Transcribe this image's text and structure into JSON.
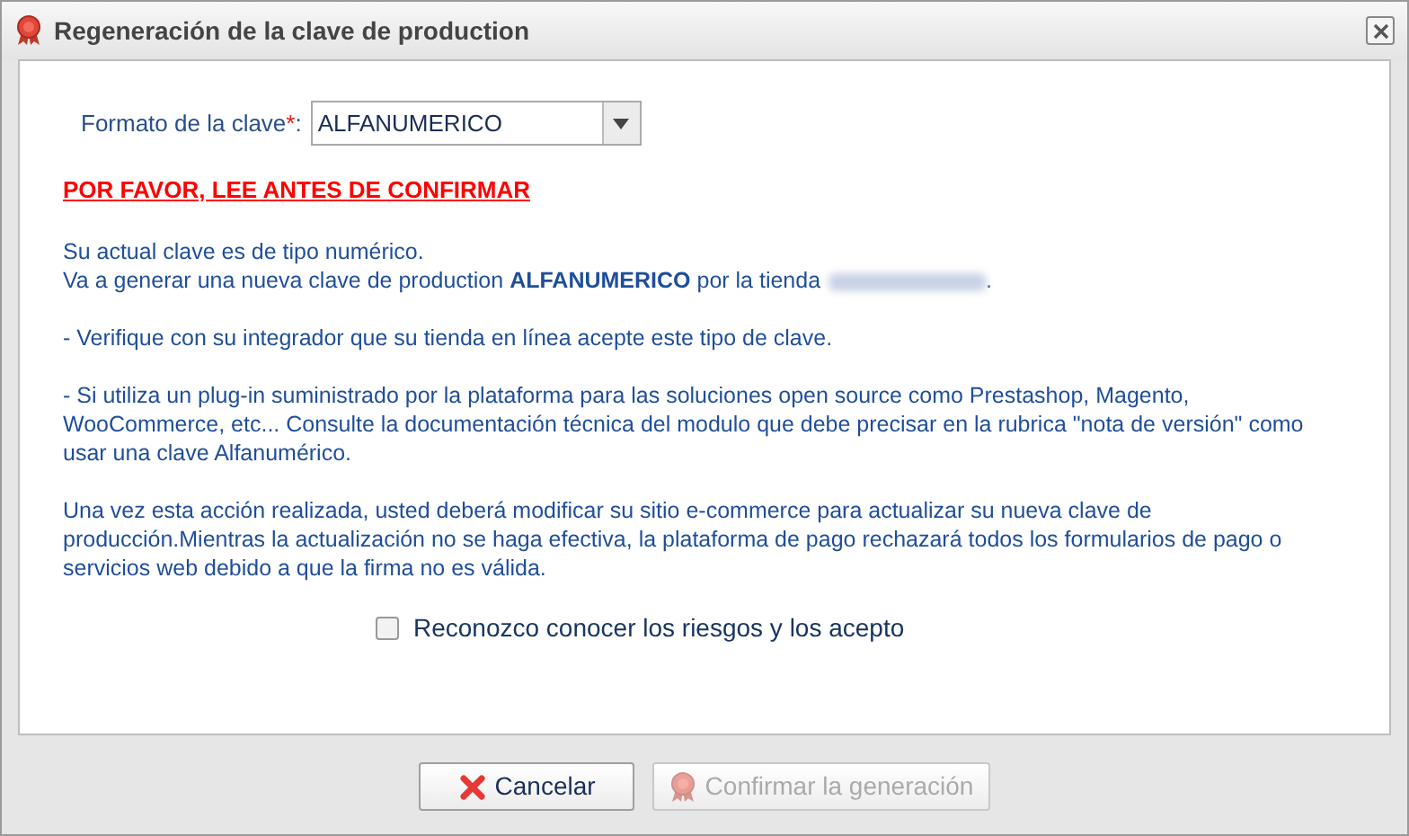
{
  "window": {
    "title": "Regeneración de la clave de production"
  },
  "format_field": {
    "label": "Formato de la clave",
    "required_mark": "*",
    "colon": ":",
    "value": "ALFANUMERICO"
  },
  "warning_heading": "POR FAVOR, LEE ANTES DE CONFIRMAR",
  "paragraphs": [
    {
      "kind": "store",
      "lines": [
        "Su actual clave es de tipo numérico.",
        "Va a generar una nueva clave de production **ALFANUMERICO** por la tienda"
      ],
      "end": "."
    },
    {
      "kind": "text",
      "lines": [
        "- Verifique con su integrador que su tienda en línea acepte este tipo de clave."
      ]
    },
    {
      "kind": "text",
      "lines": [
        "- Si utiliza un plug-in suministrado por la plataforma para las soluciones open source como Prestashop, Magento, WooCommerce, etc... Consulte la documentación técnica del modulo que debe precisar en la rubrica \"nota de versión\" como usar una clave Alfanumérico."
      ]
    },
    {
      "kind": "text",
      "lines": [
        "Una vez esta acción realizada, usted deberá modificar su sitio e-commerce para actualizar su nueva clave de producción.Mientras la actualización no se haga efectiva, la plataforma de pago rechazará todos los formularios de pago o servicios web debido a que la firma no es válida."
      ]
    }
  ],
  "acknowledge": {
    "label": "Reconozco conocer los riesgos y los acepto",
    "checked": false
  },
  "buttons": [
    {
      "kind": "cancel",
      "label": "Cancelar",
      "disabled": false
    },
    {
      "kind": "confirm",
      "label": "Confirmar la generación",
      "disabled": true
    }
  ]
}
